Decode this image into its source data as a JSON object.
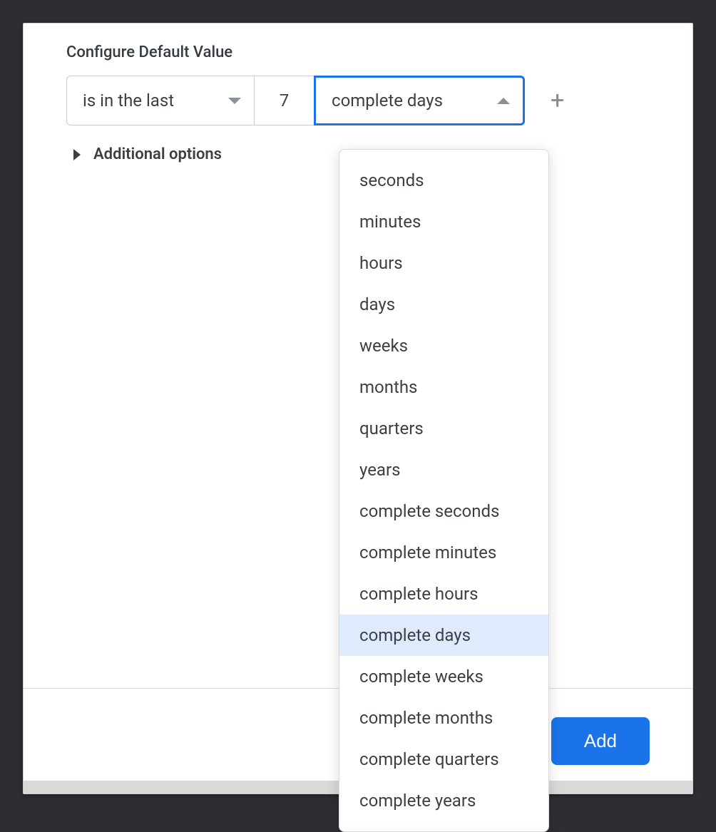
{
  "section_title": "Configure Default Value",
  "filter": {
    "operator_label": "is in the last",
    "number_value": "7",
    "unit_label": "complete days"
  },
  "additional_label": "Additional options",
  "dropdown": {
    "options": [
      "seconds",
      "minutes",
      "hours",
      "days",
      "weeks",
      "months",
      "quarters",
      "years",
      "complete seconds",
      "complete minutes",
      "complete hours",
      "complete days",
      "complete weeks",
      "complete months",
      "complete quarters",
      "complete years"
    ],
    "selected": "complete days"
  },
  "footer": {
    "add_label": "Add"
  }
}
